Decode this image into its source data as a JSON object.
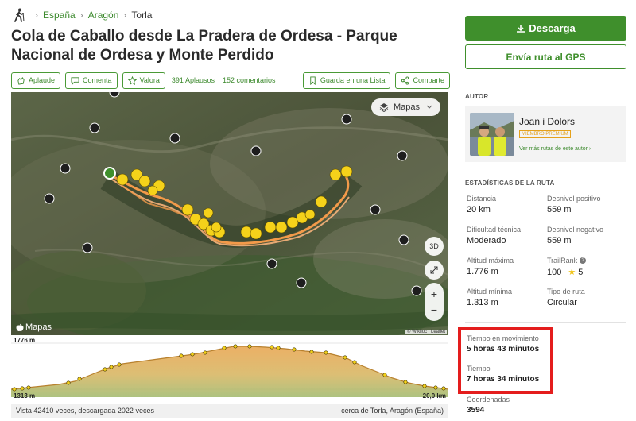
{
  "breadcrumb": {
    "items": [
      "España",
      "Aragón"
    ],
    "current": "Torla"
  },
  "title": "Cola de Caballo desde La Pradera de Ordesa - Parque Nacional de Ordesa y Monte Perdido",
  "actions": {
    "applaud": "Aplaude",
    "comment": "Comenta",
    "rate": "Valora",
    "applause_count": "391 Aplausos",
    "comment_count": "152 comentarios",
    "save_list": "Guarda en una Lista",
    "share": "Comparte"
  },
  "map": {
    "layer_button": "Mapas",
    "btn_3d": "3D",
    "zoom_in": "+",
    "zoom_out": "−",
    "watermark": "Mapas",
    "attribution": "© Wikiloc | Leaflet"
  },
  "elevation": {
    "max": "1776 m",
    "min": "1313 m",
    "distance": "20,0 km"
  },
  "footer": {
    "views": "Vista 42410 veces, descargada 2022 veces",
    "near": "cerca de Torla, Aragón (España)"
  },
  "sidebar": {
    "download": "Descarga",
    "send_gps": "Envía ruta al GPS",
    "author_heading": "AUTOR",
    "author_name": "Joan i Dolors",
    "author_badge": "MIEMBRO PREMIUM",
    "author_more": "Ver más rutas de este autor ›",
    "stats_heading": "ESTADÍSTICAS DE LA RUTA",
    "stats": {
      "distance_label": "Distancia",
      "distance_value": "20 km",
      "ascent_label": "Desnivel positivo",
      "ascent_value": "559 m",
      "difficulty_label": "Dificultad técnica",
      "difficulty_value": "Moderado",
      "descent_label": "Desnivel negativo",
      "descent_value": "559 m",
      "maxalt_label": "Altitud máxima",
      "maxalt_value": "1.776 m",
      "trailrank_label": "TrailRank",
      "trailrank_value": "100",
      "trailrank_stars": "5",
      "minalt_label": "Altitud mínima",
      "minalt_value": "1.313 m",
      "routetype_label": "Tipo de ruta",
      "routetype_value": "Circular",
      "moving_label": "Tiempo en movimiento",
      "moving_value": "5 horas 43 minutos",
      "time_label": "Tiempo",
      "time_value": "7 horas 34 minutos",
      "coords_label": "Coordenadas",
      "coords_value": "3594"
    }
  },
  "colors": {
    "brand_green": "#3f8f2c",
    "highlight_red": "#e41d1d",
    "track_orange": "#f39a4a",
    "waypoint_yellow": "#f5d21a"
  }
}
